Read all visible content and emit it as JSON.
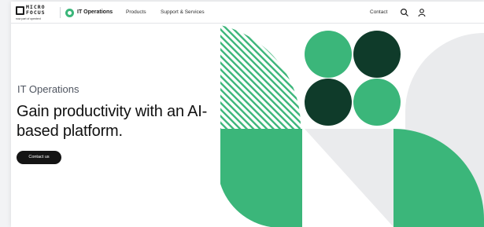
{
  "header": {
    "logo_line1": "MICRO",
    "logo_line2": "FOCUS",
    "logo_sub": "now part of opentext",
    "brand_label": "IT Operations",
    "nav": {
      "products": "Products",
      "support": "Support & Services",
      "contact": "Contact"
    },
    "icons": {
      "search": "search-icon",
      "user": "user-icon"
    }
  },
  "hero": {
    "eyebrow": "IT Operations",
    "headline": "Gain productivity with an AI-based platform.",
    "cta_label": "Contact us"
  },
  "colors": {
    "brand_green": "#3bb67a",
    "dark_green": "#0f3b2a",
    "light_gray": "#eaebed",
    "cta_bg": "#141414"
  }
}
